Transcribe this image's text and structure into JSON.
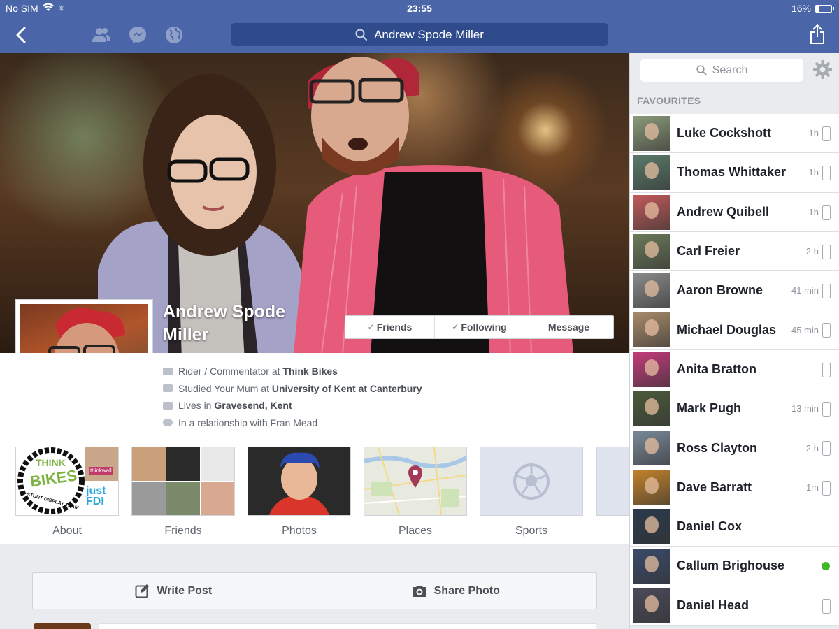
{
  "status": {
    "carrier": "No SIM",
    "time": "23:55",
    "battery": "16%",
    "battery_level": 0.16
  },
  "nav": {
    "search_value": "Andrew Spode Miller"
  },
  "profile": {
    "name": "Andrew Spode Miller",
    "name_line1": "Andrew Spode",
    "name_line2": "Miller",
    "actions": {
      "friends": "Friends",
      "following": "Following",
      "message": "Message"
    },
    "info": [
      {
        "prefix": "Rider / Commentator at ",
        "bold": "Think Bikes"
      },
      {
        "prefix": "Studied Your Mum at ",
        "bold": "University of Kent at Canterbury"
      },
      {
        "prefix": "Lives in ",
        "bold": "Gravesend, Kent"
      },
      {
        "prefix": "In a relationship with Fran Mead",
        "bold": ""
      }
    ],
    "tiles": [
      "About",
      "Friends",
      "Photos",
      "Places",
      "Sports"
    ],
    "about_tile_text": {
      "logo_top": "THINK",
      "logo_main": "BIKES",
      "logo_ring": "STUNT DISPLAY TEAM",
      "thinkwall": "thinkwall",
      "justfdi": "just FDI"
    }
  },
  "composer": {
    "write_post": "Write Post",
    "share_photo": "Share Photo"
  },
  "sidebar": {
    "search_placeholder": "Search",
    "section": "FAVOURITES",
    "contacts": [
      {
        "name": "Luke Cockshott",
        "time": "1h",
        "status": "mobile",
        "avatar_color": "#8a9a7a"
      },
      {
        "name": "Thomas Whittaker",
        "time": "1h",
        "status": "mobile",
        "avatar_color": "#5a7a6a"
      },
      {
        "name": "Andrew Quibell",
        "time": "1h",
        "status": "mobile",
        "avatar_color": "#c25a5a"
      },
      {
        "name": "Carl Freier",
        "time": "2 h",
        "status": "mobile",
        "avatar_color": "#6a7a5a"
      },
      {
        "name": "Aaron Browne",
        "time": "41 min",
        "status": "mobile",
        "avatar_color": "#8a8a8a"
      },
      {
        "name": "Michael Douglas",
        "time": "45 min",
        "status": "mobile",
        "avatar_color": "#a88a6a"
      },
      {
        "name": "Anita Bratton",
        "time": "",
        "status": "mobile",
        "avatar_color": "#c23a7a"
      },
      {
        "name": "Mark Pugh",
        "time": "13 min",
        "status": "mobile",
        "avatar_color": "#4a5a3a"
      },
      {
        "name": "Ross Clayton",
        "time": "2 h",
        "status": "mobile",
        "avatar_color": "#7a8a9a"
      },
      {
        "name": "Dave Barratt",
        "time": "1m",
        "status": "mobile",
        "avatar_color": "#c2822a"
      },
      {
        "name": "Daniel Cox",
        "time": "",
        "status": "none",
        "avatar_color": "#2a3a4a"
      },
      {
        "name": "Callum Brighouse",
        "time": "",
        "status": "online",
        "avatar_color": "#3a4a6a"
      },
      {
        "name": "Daniel Head",
        "time": "",
        "status": "mobile",
        "avatar_color": "#4a4a5a"
      }
    ]
  },
  "colors": {
    "brand": "#4a66a8",
    "online": "#42b72a"
  }
}
